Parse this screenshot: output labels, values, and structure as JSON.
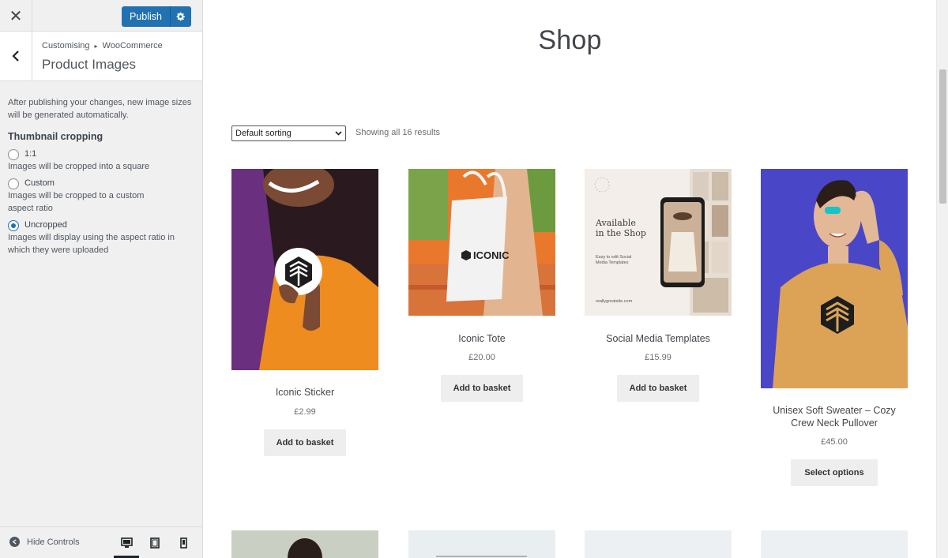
{
  "sidebar": {
    "publish_label": "Publish",
    "breadcrumb": {
      "root": "Customising",
      "current": "WooCommerce"
    },
    "section_title": "Product Images",
    "description": "After publishing your changes, new image sizes will be generated automatically.",
    "thumbnail_heading": "Thumbnail cropping",
    "options": [
      {
        "label": "1:1",
        "help": "Images will be cropped into a square",
        "checked": false
      },
      {
        "label": "Custom",
        "help": "Images will be cropped to a custom aspect ratio",
        "checked": false
      },
      {
        "label": "Uncropped",
        "help": "Images will display using the aspect ratio in which they were uploaded",
        "checked": true
      }
    ],
    "hide_controls_label": "Hide Controls",
    "devices": [
      "desktop",
      "tablet",
      "mobile"
    ],
    "active_device": "desktop"
  },
  "shop": {
    "title": "Shop",
    "sorting_value": "Default sorting",
    "result_count": "Showing all 16 results",
    "products": [
      {
        "name": "Iconic Sticker",
        "price": "£2.99",
        "button": "Add to basket"
      },
      {
        "name": "Iconic Tote",
        "price": "£20.00",
        "button": "Add to basket"
      },
      {
        "name": "Social Media Templates",
        "price": "£15.99",
        "button": "Add to basket"
      },
      {
        "name": "Unisex Soft Sweater – Cozy Crew Neck Pullover",
        "price": "£45.00",
        "button": "Select options"
      }
    ],
    "social_image_text": {
      "headline": "Available in the Shop",
      "sub": "Easy to edit Social Media Templates",
      "site": "reallygreatsite.com"
    },
    "tote_logo": "ICONIC"
  },
  "colors": {
    "accent": "#2271b1",
    "sidebar_bg": "#f0f0f1",
    "button_bg": "#eeeeee"
  }
}
